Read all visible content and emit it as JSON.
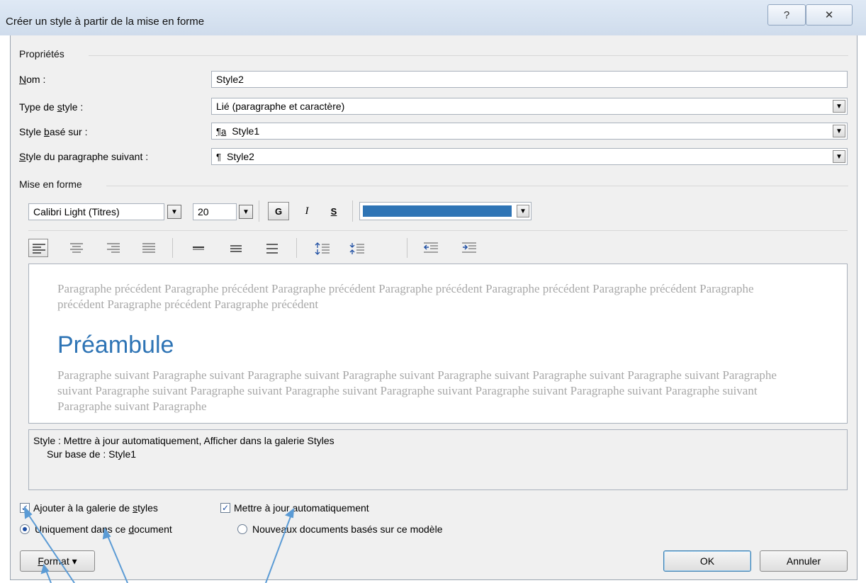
{
  "window": {
    "title": "Créer un style à partir de la mise en forme",
    "help_icon": "?",
    "close_icon": "✕"
  },
  "properties": {
    "section_label": "Propriétés",
    "name": {
      "label_u": "N",
      "label_rest": "om :",
      "value": "Style2"
    },
    "style_type": {
      "label_pre": "Type de ",
      "label_u": "s",
      "label_rest": "tyle :",
      "value": "Lié (paragraphe et caractère)"
    },
    "based_on": {
      "label_pre": "Style ",
      "label_u": "b",
      "label_rest": "asé sur :",
      "symbol": "¶a",
      "value": "Style1"
    },
    "next_para": {
      "label_u": "S",
      "label_rest": "tyle du paragraphe suivant :",
      "symbol": "¶",
      "value": "Style2"
    }
  },
  "formatting": {
    "section_label": "Mise en forme",
    "font": "Calibri Light (Titres)",
    "size": "20",
    "bold": "G",
    "italic": "I",
    "underline": "S",
    "color": "#2e74b5"
  },
  "preview": {
    "previous": "Paragraphe précédent Paragraphe précédent Paragraphe précédent Paragraphe précédent Paragraphe précédent Paragraphe précédent Paragraphe précédent Paragraphe précédent Paragraphe précédent",
    "heading": "Préambule",
    "following": "Paragraphe suivant Paragraphe suivant Paragraphe suivant Paragraphe suivant Paragraphe suivant Paragraphe suivant Paragraphe suivant Paragraphe suivant Paragraphe suivant Paragraphe suivant Paragraphe suivant Paragraphe suivant Paragraphe suivant Paragraphe suivant Paragraphe suivant Paragraphe suivant Paragraphe"
  },
  "description": {
    "line1": "Style : Mettre à jour automatiquement, Afficher dans la galerie Styles",
    "line2": "Sur base de : Style1"
  },
  "options": {
    "add_gallery": {
      "pre": "Ajouter à la galerie de ",
      "u": "s",
      "rest": "tyles",
      "checked": true
    },
    "auto_update": {
      "text": "Mettre à jour automatiquement",
      "checked": true
    },
    "only_doc": {
      "pre": "Uniquement dans ce ",
      "u": "d",
      "rest": "ocument",
      "selected": true
    },
    "new_docs": {
      "text": "Nouveaux documents basés sur ce modèle",
      "selected": false
    }
  },
  "buttons": {
    "format_u": "F",
    "format_rest": "ormat ▾",
    "ok": "OK",
    "cancel": "Annuler"
  }
}
